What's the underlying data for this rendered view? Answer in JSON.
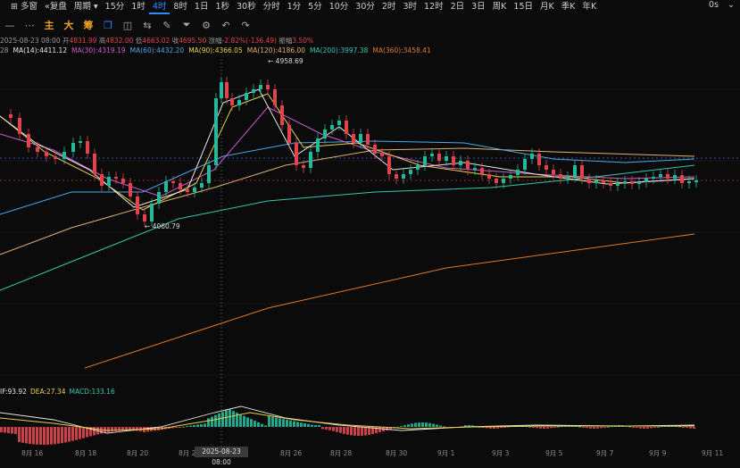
{
  "toolbar": {
    "left_items": [
      "",
      "多窗",
      "复盘",
      "周期"
    ],
    "periods": [
      "15分",
      "1时",
      "4时",
      "8时",
      "1日",
      "1秒",
      "30秒",
      "分时",
      "1分",
      "5分",
      "10分",
      "30分",
      "2时",
      "3时",
      "12时",
      "2日",
      "3日",
      "周K",
      "15日",
      "月K",
      "季K",
      "年K"
    ],
    "active_period": "4时",
    "right_items": [
      "0s",
      "⌄"
    ]
  },
  "toolbar2": {
    "indicators": [
      "主",
      "大",
      "筹"
    ]
  },
  "info_line": {
    "date": "2025-08-23 08:00",
    "open_label": "开",
    "open": "4831.99",
    "high_label": "高",
    "high": "4832.00",
    "low_label": "低",
    "low": "4663.02",
    "close_label": "收",
    "close": "4695.50",
    "change_label": "涨幅",
    "change": "-2.82%(-136.49)",
    "amp_label": "振幅",
    "amp": "3.50%"
  },
  "ma_line": [
    {
      "text": "28",
      "color": "#9a9a9a"
    },
    {
      "text": "MA(14):4411.12",
      "color": "#e8e8e8"
    },
    {
      "text": "MA(30):4319.19",
      "color": "#d05ad0"
    },
    {
      "text": "MA(60):4432.20",
      "color": "#4aa8e8"
    },
    {
      "text": "MA(90):4366.05",
      "color": "#e8d24a"
    },
    {
      "text": "MA(120):4186.00",
      "color": "#e0b070"
    },
    {
      "text": "MA(200):3997.38",
      "color": "#34c8b0"
    },
    {
      "text": "MA(360):3458.41",
      "color": "#e07a2a"
    }
  ],
  "macd_line": [
    {
      "text": "IF:93.92",
      "color": "#e8e8e8"
    },
    {
      "text": "DEA:27.34",
      "color": "#e8d24a"
    },
    {
      "text": "MACD:133.16",
      "color": "#34c8b0"
    }
  ],
  "price_labels": {
    "high": "4958.69",
    "low": "4060.79"
  },
  "x_axis": [
    "8月 16",
    "8月 18",
    "8月 20",
    "8月 2",
    "8月 26",
    "8月 28",
    "8月 30",
    "9月 1",
    "9月 3",
    "9月 5",
    "9月 7",
    "9月 9",
    "9月 11"
  ],
  "crosshair_date": "2025-08-23 08:00",
  "colors": {
    "up": "#26b89a",
    "down": "#e0454e",
    "accent": "#2f8cff"
  }
}
